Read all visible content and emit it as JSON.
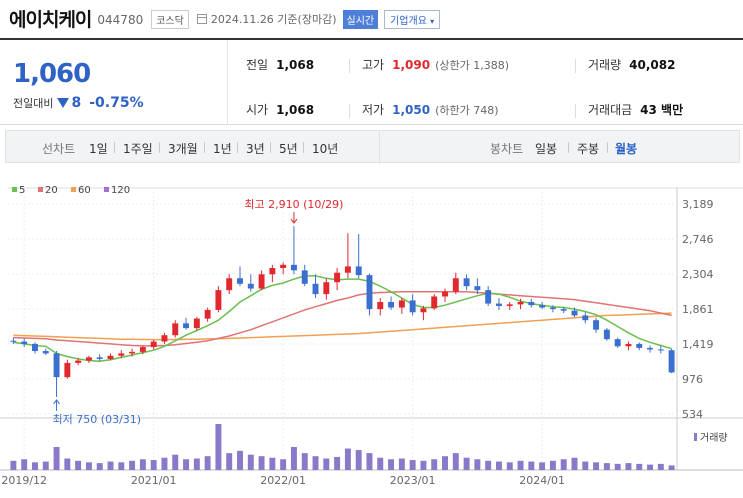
{
  "header": {
    "name": "에이치케이",
    "code": "044780",
    "market": "코스닥",
    "date": "2024.11.26 기준(장마감)",
    "live": "실시간",
    "corp_info": "기업개요"
  },
  "quote": {
    "price": "1,060",
    "vs_label": "전일대비",
    "change": "8",
    "change_pct": "-0.75%",
    "prev_close_label": "전일",
    "prev_close": "1,068",
    "high_label": "고가",
    "high": "1,090",
    "upper_limit": "(상한가 1,388)",
    "volume_label": "거래량",
    "volume": "40,082",
    "open_label": "시가",
    "open": "1,068",
    "low_label": "저가",
    "low": "1,050",
    "lower_limit": "(하한가 748)",
    "turnover_label": "거래대금",
    "turnover": "43 백만"
  },
  "periods": {
    "line_label": "선차트",
    "line_options": [
      "1일",
      "1주일",
      "3개월",
      "1년",
      "3년",
      "5년",
      "10년"
    ],
    "candle_label": "봉차트",
    "candle_options": [
      "일봉",
      "주봉",
      "월봉"
    ],
    "selected_candle": "월봉"
  },
  "colors": {
    "up": "#e0282e",
    "down": "#3a6fd0",
    "ma5": "#6bbf4f",
    "ma20": "#e07474",
    "ma60": "#f0a050",
    "ma120": "#a070d0",
    "volume": "#8a78c8"
  },
  "chart_data": {
    "type": "candlestick",
    "ylim": [
      534,
      3189
    ],
    "y_ticks": [
      "3,189",
      "2,746",
      "2,304",
      "1,861",
      "1,419",
      "976",
      "534"
    ],
    "x_ticks": [
      "2019/12",
      "2021/01",
      "2022/01",
      "2023/01",
      "2024/01"
    ],
    "legend": [
      "5",
      "20",
      "60",
      "120"
    ],
    "annotations": {
      "high": "최고 2,910 (10/29)",
      "low": "최저 750 (03/31)"
    },
    "volume_legend": "거래량",
    "candles": [
      [
        1460,
        1500,
        1420,
        1450
      ],
      [
        1450,
        1490,
        1380,
        1420
      ],
      [
        1420,
        1440,
        1300,
        1330
      ],
      [
        1330,
        1360,
        1280,
        1300
      ],
      [
        1300,
        1330,
        750,
        1000
      ],
      [
        1000,
        1220,
        980,
        1180
      ],
      [
        1180,
        1240,
        1150,
        1210
      ],
      [
        1210,
        1270,
        1180,
        1250
      ],
      [
        1250,
        1290,
        1200,
        1230
      ],
      [
        1230,
        1300,
        1210,
        1270
      ],
      [
        1270,
        1340,
        1240,
        1300
      ],
      [
        1300,
        1360,
        1260,
        1320
      ],
      [
        1320,
        1400,
        1290,
        1380
      ],
      [
        1380,
        1470,
        1350,
        1450
      ],
      [
        1450,
        1560,
        1420,
        1530
      ],
      [
        1530,
        1720,
        1500,
        1680
      ],
      [
        1680,
        1750,
        1600,
        1620
      ],
      [
        1620,
        1760,
        1590,
        1740
      ],
      [
        1740,
        1880,
        1700,
        1850
      ],
      [
        1850,
        2150,
        1820,
        2100
      ],
      [
        2100,
        2300,
        2050,
        2250
      ],
      [
        2250,
        2400,
        2150,
        2180
      ],
      [
        2180,
        2300,
        2080,
        2120
      ],
      [
        2120,
        2350,
        2100,
        2300
      ],
      [
        2300,
        2420,
        2200,
        2380
      ],
      [
        2380,
        2450,
        2300,
        2420
      ],
      [
        2420,
        2910,
        2300,
        2350
      ],
      [
        2350,
        2420,
        2150,
        2180
      ],
      [
        2180,
        2300,
        2000,
        2050
      ],
      [
        2050,
        2250,
        1980,
        2200
      ],
      [
        2200,
        2380,
        2100,
        2320
      ],
      [
        2320,
        2820,
        2250,
        2400
      ],
      [
        2400,
        2810,
        2250,
        2290
      ],
      [
        2290,
        2310,
        1780,
        1860
      ],
      [
        1860,
        2000,
        1780,
        1950
      ],
      [
        1950,
        2020,
        1850,
        1880
      ],
      [
        1880,
        2000,
        1800,
        1970
      ],
      [
        1970,
        2050,
        1780,
        1820
      ],
      [
        1820,
        1900,
        1720,
        1870
      ],
      [
        1870,
        2050,
        1850,
        2020
      ],
      [
        2020,
        2120,
        1950,
        2080
      ],
      [
        2080,
        2320,
        2050,
        2250
      ],
      [
        2250,
        2300,
        2100,
        2150
      ],
      [
        2150,
        2250,
        2050,
        2100
      ],
      [
        2100,
        2150,
        1900,
        1930
      ],
      [
        1930,
        2000,
        1850,
        1900
      ],
      [
        1900,
        1950,
        1850,
        1920
      ],
      [
        1920,
        1990,
        1860,
        1950
      ],
      [
        1950,
        1990,
        1880,
        1910
      ],
      [
        1910,
        1950,
        1860,
        1880
      ],
      [
        1880,
        1910,
        1820,
        1860
      ],
      [
        1860,
        1890,
        1810,
        1840
      ],
      [
        1840,
        1880,
        1760,
        1780
      ],
      [
        1780,
        1820,
        1680,
        1720
      ],
      [
        1720,
        1750,
        1560,
        1600
      ],
      [
        1600,
        1620,
        1460,
        1480
      ],
      [
        1480,
        1500,
        1370,
        1390
      ],
      [
        1390,
        1450,
        1340,
        1420
      ],
      [
        1420,
        1440,
        1340,
        1370
      ],
      [
        1370,
        1400,
        1310,
        1350
      ],
      [
        1350,
        1400,
        1300,
        1340
      ],
      [
        1340,
        1360,
        1050,
        1060
      ]
    ],
    "ma5": [
      1440,
      1420,
      1400,
      1390,
      1300,
      1260,
      1230,
      1210,
      1200,
      1220,
      1250,
      1280,
      1310,
      1340,
      1390,
      1460,
      1530,
      1590,
      1650,
      1720,
      1830,
      1950,
      2030,
      2110,
      2160,
      2190,
      2240,
      2280,
      2280,
      2250,
      2230,
      2240,
      2240,
      2210,
      2150,
      2080,
      2000,
      1920,
      1880,
      1880,
      1910,
      1950,
      1990,
      2030,
      2060,
      2050,
      2010,
      1960,
      1930,
      1910,
      1890,
      1880,
      1860,
      1830,
      1790,
      1720,
      1640,
      1560,
      1490,
      1440,
      1400,
      1360
    ],
    "ma20": [
      1500,
      1495,
      1490,
      1485,
      1470,
      1460,
      1450,
      1440,
      1430,
      1420,
      1410,
      1400,
      1395,
      1395,
      1400,
      1410,
      1425,
      1440,
      1460,
      1490,
      1520,
      1560,
      1600,
      1650,
      1700,
      1750,
      1800,
      1850,
      1890,
      1930,
      1970,
      2000,
      2040,
      2060,
      2070,
      2075,
      2080,
      2080,
      2080,
      2080,
      2080,
      2080,
      2080,
      2070,
      2060,
      2050,
      2040,
      2030,
      2020,
      2010,
      2000,
      1990,
      1980,
      1960,
      1940,
      1920,
      1900,
      1880,
      1860,
      1840,
      1810,
      1780
    ],
    "ma60": [
      1530,
      1525,
      1520,
      1515,
      1510,
      1505,
      1500,
      1495,
      1490,
      1485,
      1480,
      1478,
      1476,
      1475,
      1475,
      1476,
      1478,
      1480,
      1483,
      1486,
      1490,
      1495,
      1500,
      1505,
      1510,
      1515,
      1520,
      1525,
      1530,
      1535,
      1540,
      1545,
      1550,
      1560,
      1570,
      1580,
      1590,
      1600,
      1610,
      1620,
      1630,
      1640,
      1650,
      1660,
      1670,
      1680,
      1690,
      1700,
      1710,
      1720,
      1730,
      1740,
      1750,
      1760,
      1770,
      1780,
      1785,
      1790,
      1795,
      1800,
      1805,
      1810
    ],
    "volume": [
      12,
      14,
      10,
      11,
      30,
      15,
      12,
      10,
      9,
      11,
      10,
      12,
      14,
      13,
      16,
      20,
      14,
      15,
      18,
      60,
      22,
      25,
      20,
      18,
      16,
      14,
      30,
      22,
      18,
      15,
      17,
      28,
      26,
      22,
      16,
      14,
      15,
      13,
      12,
      14,
      18,
      22,
      16,
      14,
      12,
      11,
      10,
      12,
      11,
      10,
      12,
      14,
      16,
      11,
      10,
      9,
      8,
      9,
      8,
      7,
      8,
      6
    ]
  }
}
